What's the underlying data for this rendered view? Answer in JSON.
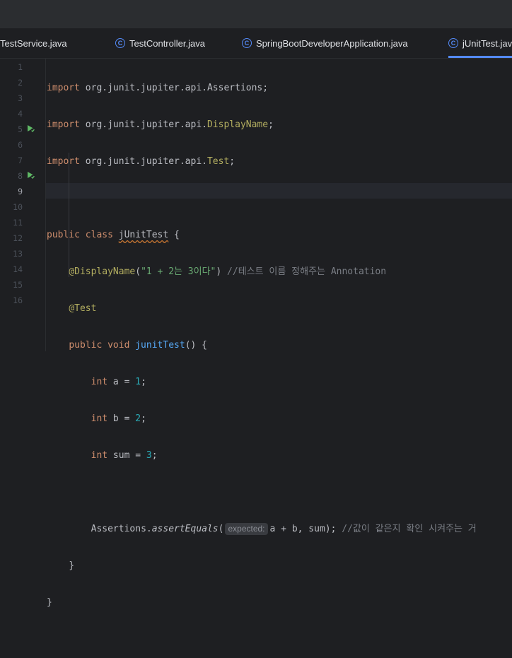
{
  "tabs": [
    {
      "label": "TestService.java"
    },
    {
      "label": "TestController.java"
    },
    {
      "label": "SpringBootDeveloperApplication.java"
    },
    {
      "label": "jUnitTest.java"
    }
  ],
  "tab_icon_letter": "C",
  "line_numbers": [
    "1",
    "2",
    "3",
    "4",
    "5",
    "6",
    "7",
    "8",
    "9",
    "10",
    "11",
    "12",
    "13",
    "14",
    "15",
    "16"
  ],
  "code": {
    "l1": {
      "kw": "import",
      "pkg": " org.junit.jupiter.api.",
      "cls": "Assertions",
      "end": ";"
    },
    "l2": {
      "kw": "import",
      "pkg": " org.junit.jupiter.api.",
      "cls": "DisplayName",
      "end": ";"
    },
    "l3": {
      "kw": "import",
      "pkg": " org.junit.jupiter.api.",
      "cls": "Test",
      "end": ";"
    },
    "l5": {
      "kw": "public class",
      "name": "jUnitTest",
      "brace": " {"
    },
    "l6": {
      "ann": "@DisplayName",
      "open": "(",
      "str": "\"1 + 2는 3이다\"",
      "close": ")",
      "cmt": " //테스트 이름 정해주는 Annotation"
    },
    "l7": {
      "ann": "@Test"
    },
    "l8": {
      "kw": "public void",
      "fn": "junitTest",
      "rest": "() {"
    },
    "l9": {
      "kw": "int",
      "decl": " a = ",
      "num": "1",
      "end": ";"
    },
    "l10": {
      "kw": "int",
      "decl": " b = ",
      "num": "2",
      "end": ";"
    },
    "l11": {
      "kw": "int",
      "decl": " sum = ",
      "num": "3",
      "end": ";"
    },
    "l13": {
      "cls": "Assertions.",
      "method": "assertEquals",
      "open": "(",
      "hint": "expected:",
      "args": "a + b, sum);",
      "cmt": " //값이 같은지 확인 시켜주는 거"
    },
    "l14": {
      "brace": "}"
    },
    "l15": {
      "brace": "}"
    }
  },
  "colors": {
    "accent": "#548af7",
    "background": "#1e1f22",
    "keyword": "#cf8e6d",
    "annotation": "#b3ae60",
    "string": "#6aab73",
    "number": "#2aacb8",
    "comment": "#7a7e85",
    "function": "#56a8f5"
  },
  "current_line": "9",
  "run_icons": [
    "run-test-class-icon",
    "run-test-method-icon"
  ]
}
